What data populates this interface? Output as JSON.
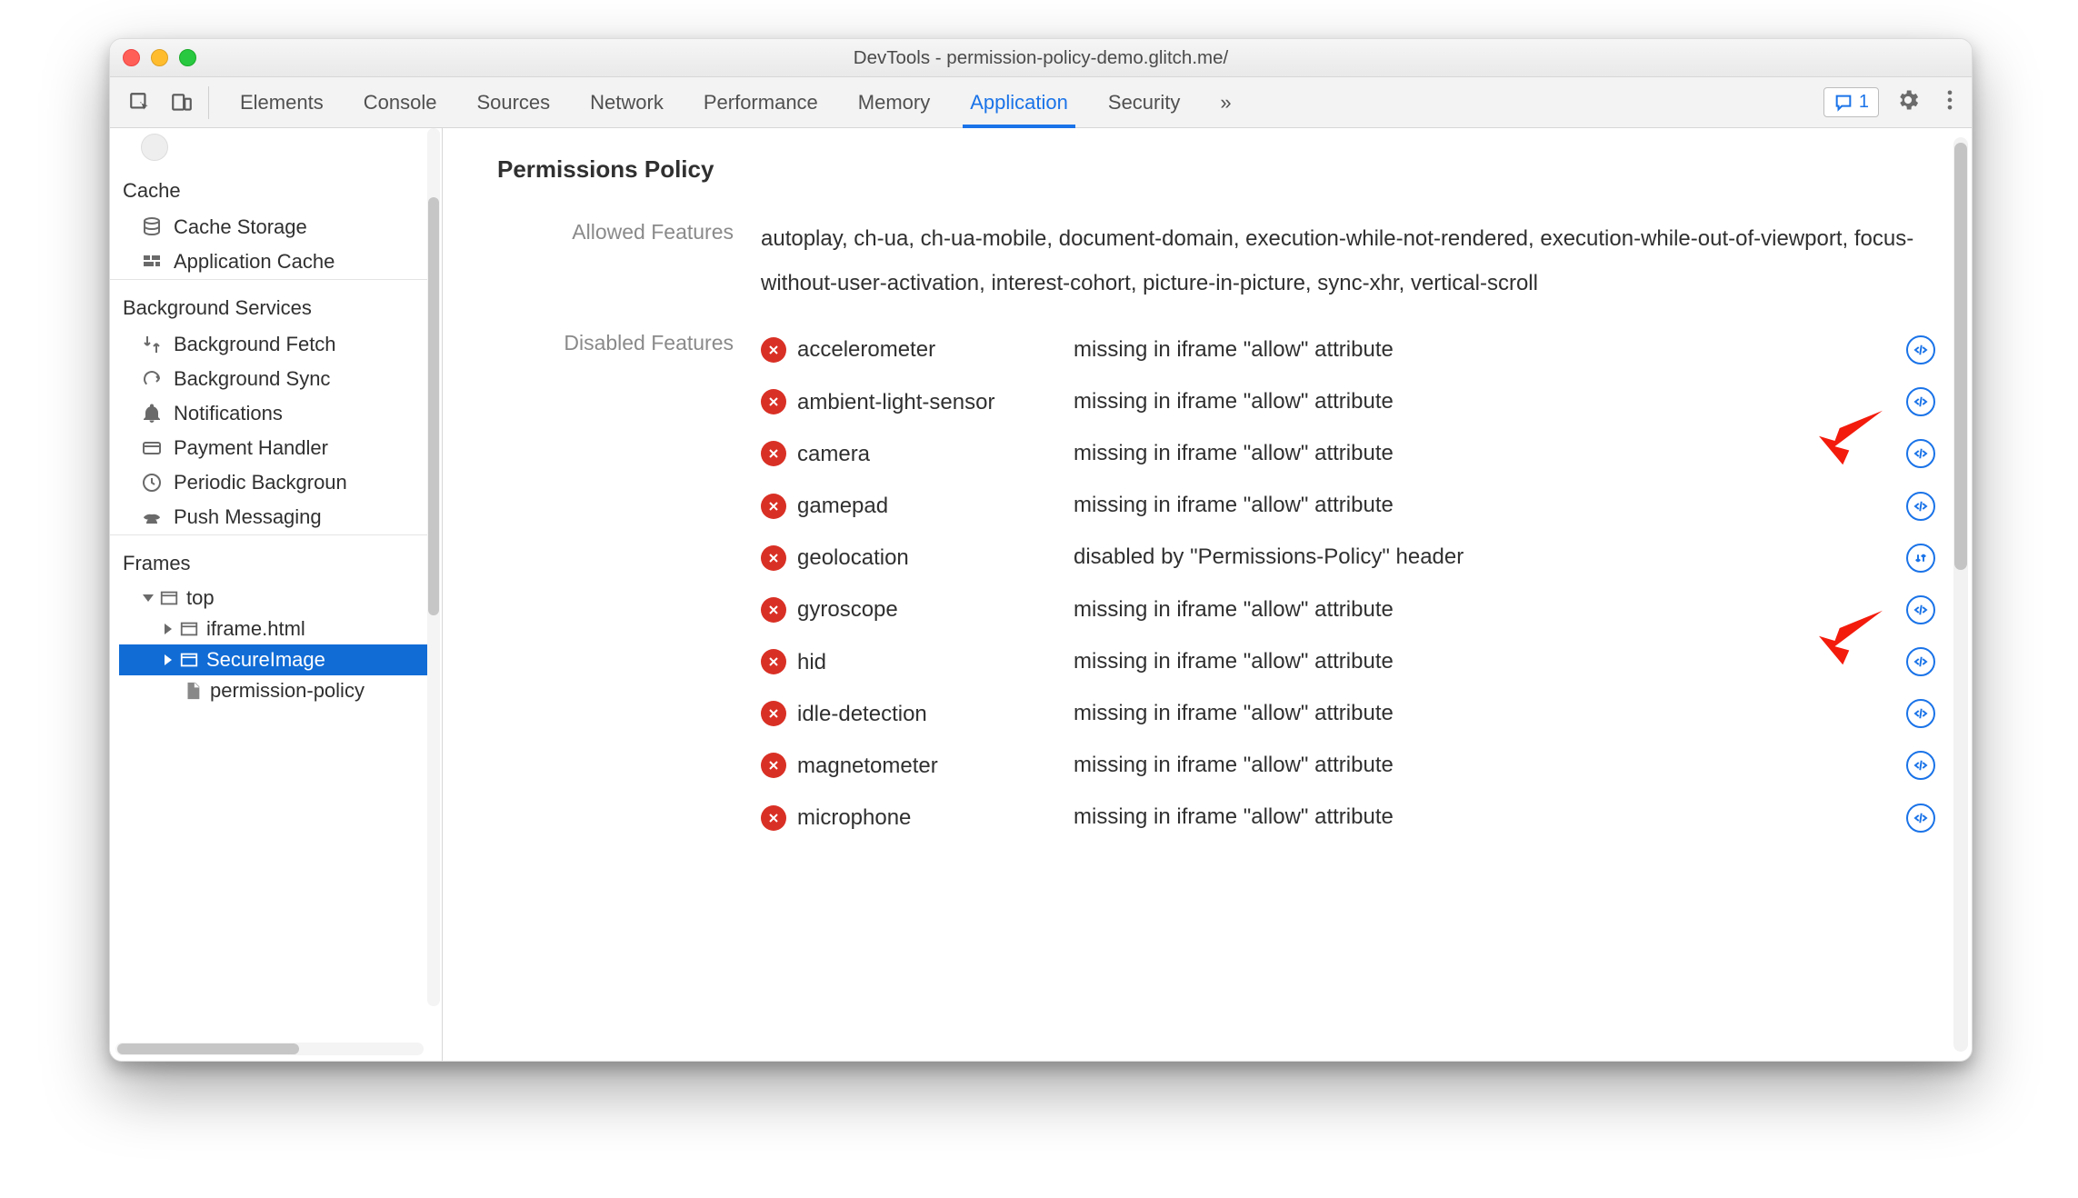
{
  "window": {
    "title": "DevTools - permission-policy-demo.glitch.me/"
  },
  "toolbar": {
    "tabs": [
      "Elements",
      "Console",
      "Sources",
      "Network",
      "Performance",
      "Memory",
      "Application",
      "Security"
    ],
    "active_tab": "Application",
    "issues_count": "1"
  },
  "sidebar": {
    "sections": {
      "cache": {
        "title": "Cache",
        "items": [
          "Cache Storage",
          "Application Cache"
        ]
      },
      "bg": {
        "title": "Background Services",
        "items": [
          "Background Fetch",
          "Background Sync",
          "Notifications",
          "Payment Handler",
          "Periodic Backgroun",
          "Push Messaging"
        ]
      },
      "frames": {
        "title": "Frames",
        "top": "top",
        "nodes": [
          "iframe.html",
          "SecureImage",
          "permission-policy"
        ]
      }
    }
  },
  "panel": {
    "title": "Permissions Policy",
    "allowed_label": "Allowed Features",
    "allowed_value": "autoplay, ch-ua, ch-ua-mobile, document-domain, execution-while-not-rendered, execution-while-out-of-viewport, focus-without-user-activation, interest-cohort, picture-in-picture, sync-xhr, vertical-scroll",
    "disabled_label": "Disabled Features",
    "disabled": [
      {
        "name": "accelerometer",
        "reason": "missing in iframe \"allow\" attribute",
        "action": "code"
      },
      {
        "name": "ambient-light-sensor",
        "reason": "missing in iframe \"allow\" attribute",
        "action": "code"
      },
      {
        "name": "camera",
        "reason": "missing in iframe \"allow\" attribute",
        "action": "code"
      },
      {
        "name": "gamepad",
        "reason": "missing in iframe \"allow\" attribute",
        "action": "code"
      },
      {
        "name": "geolocation",
        "reason": "disabled by \"Permissions-Policy\" header",
        "action": "network"
      },
      {
        "name": "gyroscope",
        "reason": "missing in iframe \"allow\" attribute",
        "action": "code"
      },
      {
        "name": "hid",
        "reason": "missing in iframe \"allow\" attribute",
        "action": "code"
      },
      {
        "name": "idle-detection",
        "reason": "missing in iframe \"allow\" attribute",
        "action": "code"
      },
      {
        "name": "magnetometer",
        "reason": "missing in iframe \"allow\" attribute",
        "action": "code"
      },
      {
        "name": "microphone",
        "reason": "missing in iframe \"allow\" attribute",
        "action": "code"
      }
    ]
  }
}
